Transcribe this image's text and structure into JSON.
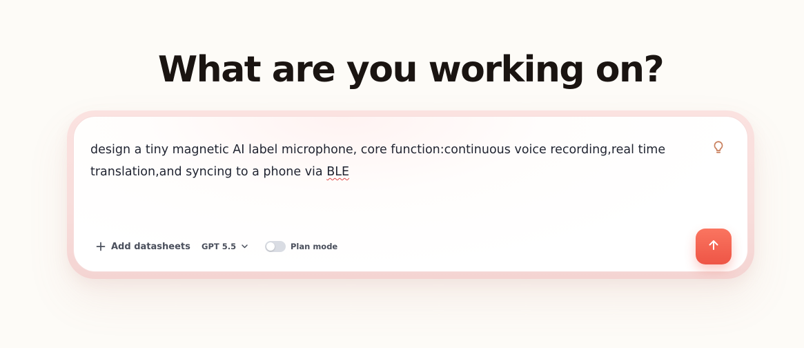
{
  "heading": "What are you working on?",
  "prompt": {
    "text_before": "design a tiny magnetic AI label microphone, core function:continuous voice recording,real time translation,and syncing to a phone via ",
    "misspelled_word": "BLE"
  },
  "toolbar": {
    "add_datasheets_label": "Add datasheets",
    "model_label": "GPT 5.5",
    "plan_mode_label": "Plan mode",
    "plan_mode_on": false
  },
  "icons": {
    "idea": "lightbulb-icon",
    "add": "plus-icon",
    "model_dropdown": "chevron-down-icon",
    "send": "arrow-up-icon"
  },
  "colors": {
    "accent": "#ee5546",
    "idea_icon": "#c9805e",
    "heading": "#1a1411",
    "background": "#fdfbf7"
  }
}
